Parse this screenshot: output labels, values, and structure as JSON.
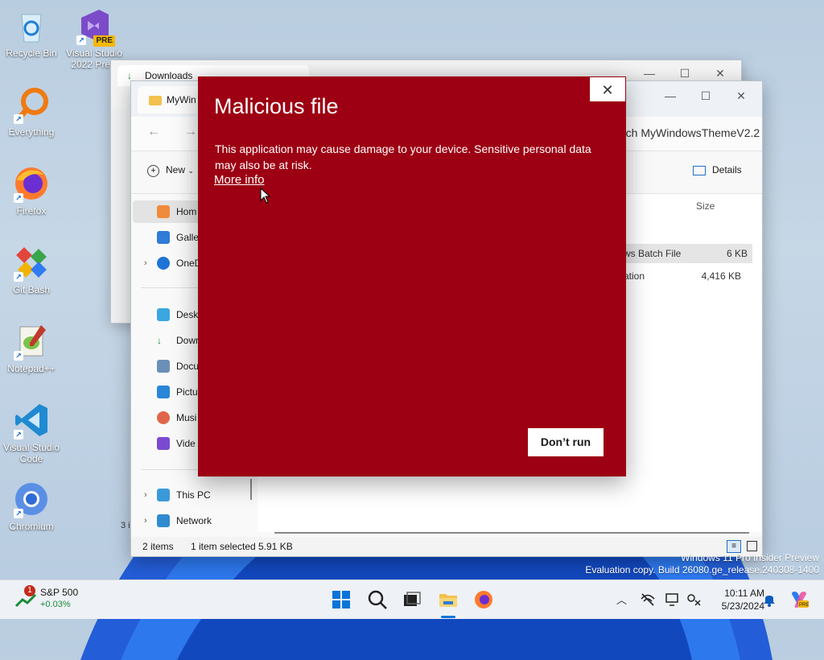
{
  "desktop": {
    "icons": [
      {
        "label_1": "Recycle Bin",
        "label_2": ""
      },
      {
        "label_1": "Visual Studio",
        "label_2": "2022 Previ",
        "badge": "PRE"
      },
      {
        "label_1": "Everything",
        "label_2": ""
      },
      {
        "label_1": "Firefox",
        "label_2": ""
      },
      {
        "label_1": "Git Bash",
        "label_2": ""
      },
      {
        "label_1": "Notepad++",
        "label_2": ""
      },
      {
        "label_1": "Visual Studio",
        "label_2": "Code"
      },
      {
        "label_1": "Chromium",
        "label_2": ""
      }
    ]
  },
  "back_window": {
    "tab_label": "Downloads"
  },
  "explorer": {
    "tab_label": "MyWin",
    "search_placeholder": "rch MyWindowsThemeV2.2",
    "new_label": "New",
    "details_label": "Details",
    "column_size": "Size",
    "nav_items": [
      "Hom",
      "Galle",
      "OneD",
      "Deskt",
      "Down",
      "Docu",
      "Pictu",
      "Musi",
      "Vide",
      "This PC",
      "Network"
    ],
    "rows": [
      {
        "type": "ws Batch File",
        "size": "6 KB"
      },
      {
        "type": "ation",
        "size": "4,416 KB"
      }
    ],
    "status_items": "2 items",
    "status_selected": "1 item selected",
    "status_size": "5.91 KB",
    "side_count": "3 i"
  },
  "dialog": {
    "title": "Malicious file",
    "message": "This application may cause damage to your device. Sensitive personal data may also be at risk.",
    "more_info": "More info",
    "button": "Don’t run",
    "close_glyph": "✕"
  },
  "watermark": {
    "line1": "Windows 11 Pro Insider Preview",
    "line2": "Evaluation copy. Build 26080.ge_release.240308-1400"
  },
  "taskbar": {
    "widget_title": "S&P 500",
    "widget_change": "+0.03%",
    "widget_badge": "1",
    "time": "10:11 AM",
    "date": "5/23/2024"
  },
  "colors": {
    "dialog_bg": "#9c0012",
    "accent": "#0067c0"
  }
}
